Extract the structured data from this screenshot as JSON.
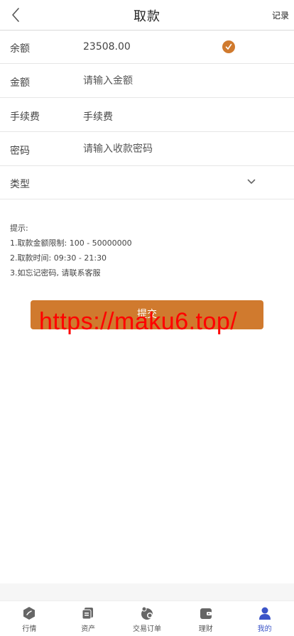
{
  "header": {
    "title": "取款",
    "records_label": "记录"
  },
  "form": {
    "balance": {
      "label": "余额",
      "value": "23508.00"
    },
    "amount": {
      "label": "金额",
      "placeholder": "请输入金额"
    },
    "fee": {
      "label": "手续费",
      "value": "手续费"
    },
    "password": {
      "label": "密码",
      "placeholder": "请输入收款密码"
    },
    "type": {
      "label": "类型",
      "value": ""
    }
  },
  "tips": {
    "heading": "提示:",
    "lines": [
      "1.取款金额限制: 100 - 50000000",
      "2.取款时间: 09:30 - 21:30",
      "3.如忘记密码, 请联系客服"
    ]
  },
  "submit_label": "提交",
  "watermark": "https://maku6.top/",
  "colors": {
    "accent": "#d07a2e",
    "active_tab": "#3b54c8",
    "icon_gray": "#666666"
  },
  "tabbar": {
    "items": [
      {
        "label": "行情",
        "icon": "market-icon"
      },
      {
        "label": "资产",
        "icon": "assets-icon"
      },
      {
        "label": "交易订单",
        "icon": "orders-icon"
      },
      {
        "label": "理财",
        "icon": "wallet-icon"
      },
      {
        "label": "我的",
        "icon": "user-icon",
        "active": true
      }
    ]
  }
}
